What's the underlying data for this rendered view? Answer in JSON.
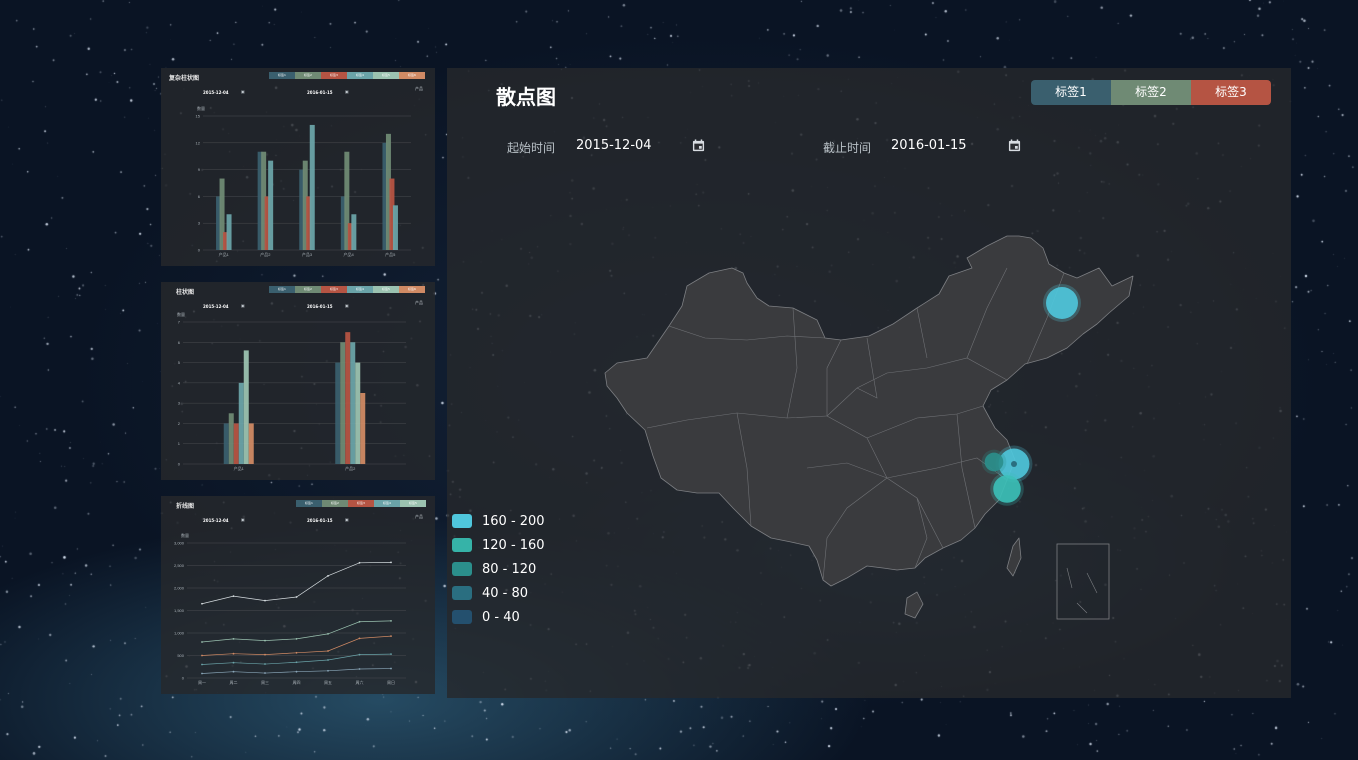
{
  "colors": {
    "tag1": "#3a5f6e",
    "tag2": "#6f8a74",
    "tag3": "#b55443",
    "tag4": "#6aa3a8",
    "tag5": "#9bc2b0",
    "tag6": "#d08a64"
  },
  "panel_complex_bar": {
    "title": "复杂柱状图",
    "tags": [
      "标签1",
      "标签2",
      "标签3",
      "标签4",
      "标签5",
      "标签6"
    ],
    "start_value": "2015-12-04",
    "end_value": "2016-01-15",
    "unit_select": "产品",
    "chart_data": {
      "type": "bar",
      "categories": [
        "产品1",
        "产品2",
        "产品3",
        "产品4",
        "产品5"
      ],
      "ylim": [
        0,
        15
      ],
      "yticks": [
        "0",
        "3",
        "6",
        "9",
        "12",
        "15"
      ],
      "y_unit": "数量",
      "series": [
        {
          "values": [
            6,
            11,
            9,
            6,
            12
          ]
        },
        {
          "values": [
            8,
            11,
            10,
            11,
            13
          ]
        },
        {
          "values": [
            2,
            6,
            6,
            3,
            8
          ]
        },
        {
          "values": [
            4,
            10,
            14,
            4,
            5
          ]
        }
      ]
    }
  },
  "panel_bar": {
    "title": "柱状图",
    "tags": [
      "标签1",
      "标签2",
      "标签3",
      "标签4",
      "标签5",
      "标签6"
    ],
    "start_value": "2015-12-04",
    "end_value": "2016-01-15",
    "unit_select": "产品",
    "chart_data": {
      "type": "bar",
      "categories": [
        "产品1",
        "产品2"
      ],
      "ylim": [
        0,
        7
      ],
      "yticks": [
        "0",
        "1",
        "2",
        "3",
        "4",
        "5",
        "6",
        "7"
      ],
      "y_unit": "数量",
      "series": [
        {
          "values": [
            2,
            5
          ]
        },
        {
          "values": [
            2.5,
            6
          ]
        },
        {
          "values": [
            2,
            6.5
          ]
        },
        {
          "values": [
            4,
            6
          ]
        },
        {
          "values": [
            5.6,
            5
          ]
        },
        {
          "values": [
            2,
            3.5
          ]
        }
      ]
    }
  },
  "panel_line": {
    "title": "折线图",
    "tags": [
      "标签1",
      "标签2",
      "标签3",
      "标签4",
      "标签5"
    ],
    "start_value": "2015-12-04",
    "end_value": "2016-01-15",
    "unit_select": "产品",
    "chart_data": {
      "type": "line",
      "categories": [
        "周一",
        "周二",
        "周三",
        "周四",
        "周五",
        "周六",
        "周日"
      ],
      "ylim": [
        0,
        3000
      ],
      "yticks": [
        "0",
        "500",
        "1,000",
        "1,500",
        "2,000",
        "2,500",
        "3,000"
      ],
      "y_unit": "数量",
      "series": [
        {
          "values": [
            1650,
            1820,
            1720,
            1800,
            2270,
            2560,
            2570
          ]
        },
        {
          "values": [
            800,
            870,
            830,
            870,
            980,
            1250,
            1270
          ]
        },
        {
          "values": [
            500,
            540,
            520,
            560,
            600,
            880,
            930
          ]
        },
        {
          "values": [
            300,
            340,
            310,
            350,
            400,
            520,
            530
          ]
        },
        {
          "values": [
            100,
            140,
            110,
            140,
            160,
            200,
            210
          ]
        }
      ]
    }
  },
  "main": {
    "title": "散点图",
    "tabs": [
      "标签1",
      "标签2",
      "标签3"
    ],
    "start_label": "起始时间",
    "start_value": "2015-12-04",
    "end_label": "截止时间",
    "end_value": "2016-01-15",
    "legend": [
      {
        "label": "160 - 200",
        "color": "#4fc6dc"
      },
      {
        "label": "120 - 160",
        "color": "#36b3a8"
      },
      {
        "label": "80 - 120",
        "color": "#2b8f8c"
      },
      {
        "label": "40 - 80",
        "color": "#2a6e80"
      },
      {
        "label": "0 - 40",
        "color": "#24506e"
      }
    ],
    "map_scatter": [
      {
        "region": "黑龙江",
        "value": 180,
        "color": "#4fc6dc"
      },
      {
        "region": "上海",
        "value": 170,
        "color": "#4fc6dc"
      },
      {
        "region": "江苏",
        "value": 60,
        "color": "#2b8f8c"
      },
      {
        "region": "浙江",
        "value": 140,
        "color": "#3cc0b8"
      }
    ]
  }
}
